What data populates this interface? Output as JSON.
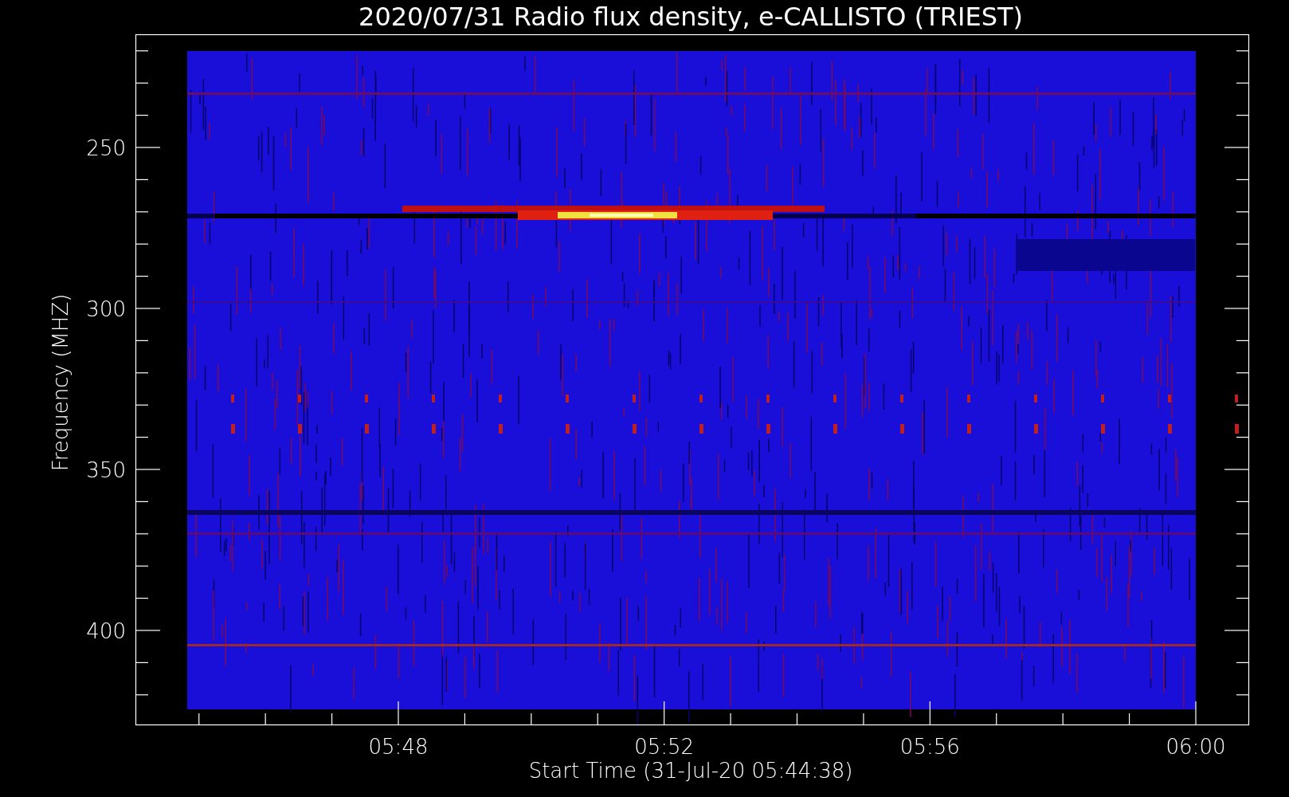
{
  "title": "2020/07/31  Radio flux density, e-CALLISTO (TRIEST)",
  "ylabel": "Frequency (MHZ)",
  "xlabel": "Start Time (31-Jul-20 05:44:38)",
  "y_tick_labels": [
    "250",
    "300",
    "350",
    "400"
  ],
  "x_tick_labels": [
    "05:48",
    "05:52",
    "05:56",
    "06:00"
  ]
}
